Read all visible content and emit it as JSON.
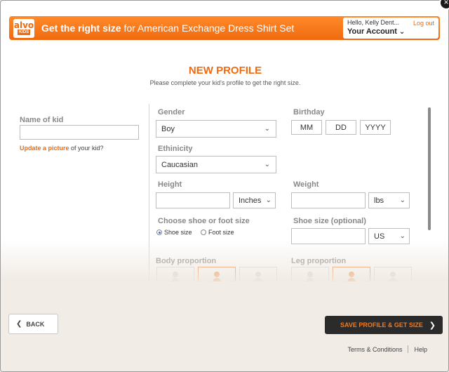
{
  "header": {
    "logo_top": "alvo",
    "logo_bottom": "KIDS",
    "title_bold": "Get the right size",
    "title_rest": " for American Exchange Dress Shirt Set",
    "hello": "Hello, Kelly Dent...",
    "logout": "Log out",
    "account": "Your Account"
  },
  "page": {
    "title": "NEW PROFILE",
    "subtitle": "Please complete your kid's profile to get the right size."
  },
  "left": {
    "name_label": "Name of kid",
    "name_value": "",
    "update_link": "Update a picture",
    "update_rest": " of your kid?"
  },
  "form": {
    "gender_label": "Gender",
    "gender_value": "Boy",
    "birthday_label": "Birthday",
    "bday_mm": "MM",
    "bday_dd": "DD",
    "bday_yyyy": "YYYY",
    "ethnicity_label": "Ethinicity",
    "ethnicity_value": "Caucasian",
    "height_label": "Height",
    "height_unit": "Inches",
    "weight_label": "Weight",
    "weight_unit": "lbs",
    "shoe_choice_label": "Choose shoe or foot size",
    "opt_shoe": "Shoe size",
    "opt_foot": "Foot size",
    "shoe_size_label": "Shoe size (optional)",
    "shoe_unit": "US",
    "body_label": "Body proportion",
    "leg_label": "Leg proportion"
  },
  "footer": {
    "back": "BACK",
    "save": "SAVE PROFILE & GET SIZE",
    "terms": "Terms & Conditions",
    "help": "Help"
  },
  "icons": {
    "close": "close-icon",
    "chevron": "chevron-down-icon"
  },
  "colors": {
    "accent": "#f06a0f",
    "dark_button": "#2b2b2b"
  }
}
